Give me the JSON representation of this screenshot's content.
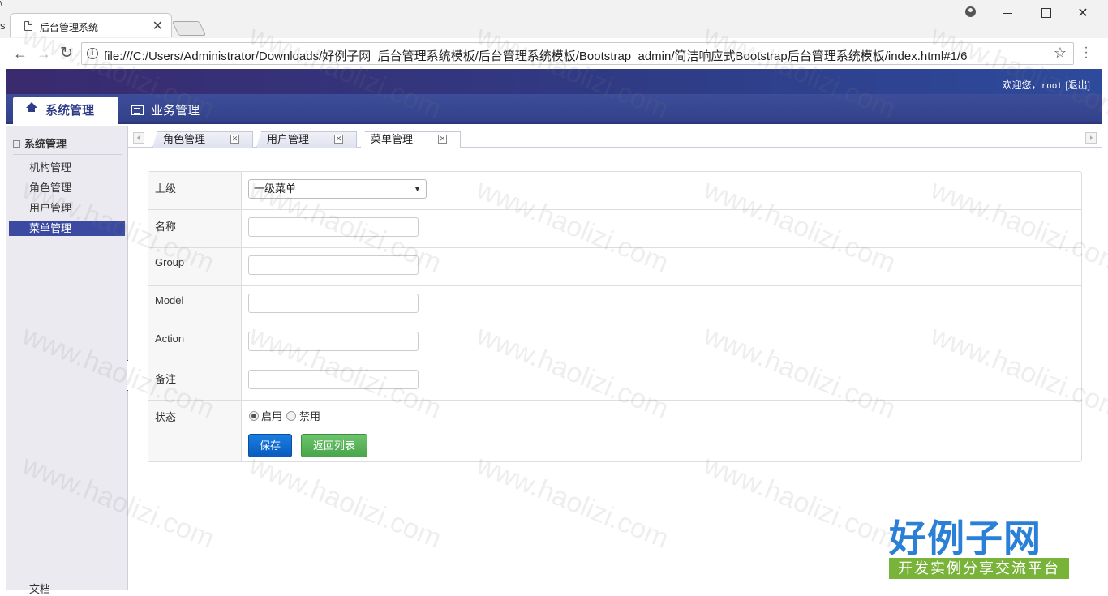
{
  "browser": {
    "tab_title": "后台管理系统",
    "tab_close": "✕",
    "url": "file:///C:/Users/Administrator/Downloads/好例子网_后台管理系统模板/后台管理系统模板/Bootstrap_admin/简洁响应式Bootstrap后台管理系统模板/index.html#1/6",
    "edge_left_text": "s",
    "edge_left_text2": "\\"
  },
  "header": {
    "welcome_prefix": "欢迎您，",
    "user": "root",
    "logout": "[退出]"
  },
  "nav": {
    "items": [
      {
        "label": "系统管理"
      },
      {
        "label": "业务管理"
      }
    ]
  },
  "sidebar": {
    "group_label": "系统管理",
    "items": [
      {
        "label": "机构管理"
      },
      {
        "label": "角色管理"
      },
      {
        "label": "用户管理"
      },
      {
        "label": "菜单管理"
      }
    ],
    "footer_item": "文档"
  },
  "tabs": [
    {
      "label": "角色管理"
    },
    {
      "label": "用户管理"
    },
    {
      "label": "菜单管理"
    }
  ],
  "form": {
    "fields": [
      {
        "label": "上级",
        "value": "一级菜单"
      },
      {
        "label": "名称",
        "value": ""
      },
      {
        "label": "Group",
        "value": ""
      },
      {
        "label": "Model",
        "value": ""
      },
      {
        "label": "Action",
        "value": ""
      },
      {
        "label": "备注",
        "value": ""
      }
    ],
    "status_label": "状态",
    "status_options": [
      "启用",
      "禁用"
    ],
    "status_selected": "启用",
    "save_label": "保存",
    "back_label": "返回列表"
  },
  "watermark": {
    "text": "www.haolizi.com",
    "logo_big": "好例子网",
    "logo_small": "开发实例分享交流平台"
  },
  "colors": {
    "header_bg": "#2f3c86",
    "sidebar_active": "#3b4aa0",
    "save_button": "#0a5bbd",
    "back_button": "#4aa64a"
  }
}
